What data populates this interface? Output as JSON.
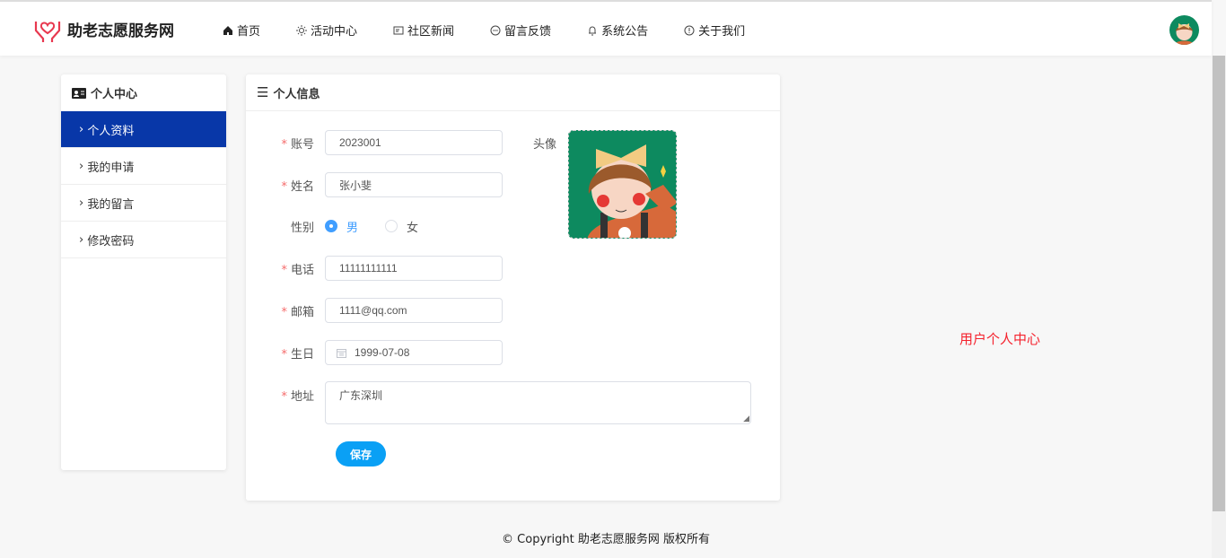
{
  "brand": {
    "name": "助老志愿服务网",
    "color": "#e8384f"
  },
  "nav": [
    {
      "label": "首页",
      "icon": "home-icon"
    },
    {
      "label": "活动中心",
      "icon": "sun-icon"
    },
    {
      "label": "社区新闻",
      "icon": "news-icon"
    },
    {
      "label": "留言反馈",
      "icon": "chat-icon"
    },
    {
      "label": "系统公告",
      "icon": "bell-icon"
    },
    {
      "label": "关于我们",
      "icon": "info-icon"
    }
  ],
  "sidebar": {
    "title": "个人中心",
    "items": [
      {
        "label": "个人资料"
      },
      {
        "label": "我的申请"
      },
      {
        "label": "我的留言"
      },
      {
        "label": "修改密码"
      }
    ],
    "active_color": "#0837a8"
  },
  "panel": {
    "title": "个人信息"
  },
  "form": {
    "account": {
      "label": "账号",
      "value": "2023001"
    },
    "name": {
      "label": "姓名",
      "value": "张小斐"
    },
    "gender": {
      "label": "性别",
      "options": [
        "男",
        "女"
      ],
      "selected": "男"
    },
    "phone": {
      "label": "电话",
      "value": "11111111111"
    },
    "email": {
      "label": "邮箱",
      "value": "1111@qq.com"
    },
    "birthday": {
      "label": "生日",
      "value": "1999-07-08"
    },
    "address": {
      "label": "地址",
      "value": "广东深圳"
    },
    "avatar": {
      "label": "头像"
    },
    "save": "保存",
    "required_mark": "*"
  },
  "right_text": "用户个人中心",
  "footer": "© Copyright 助老志愿服务网 版权所有"
}
